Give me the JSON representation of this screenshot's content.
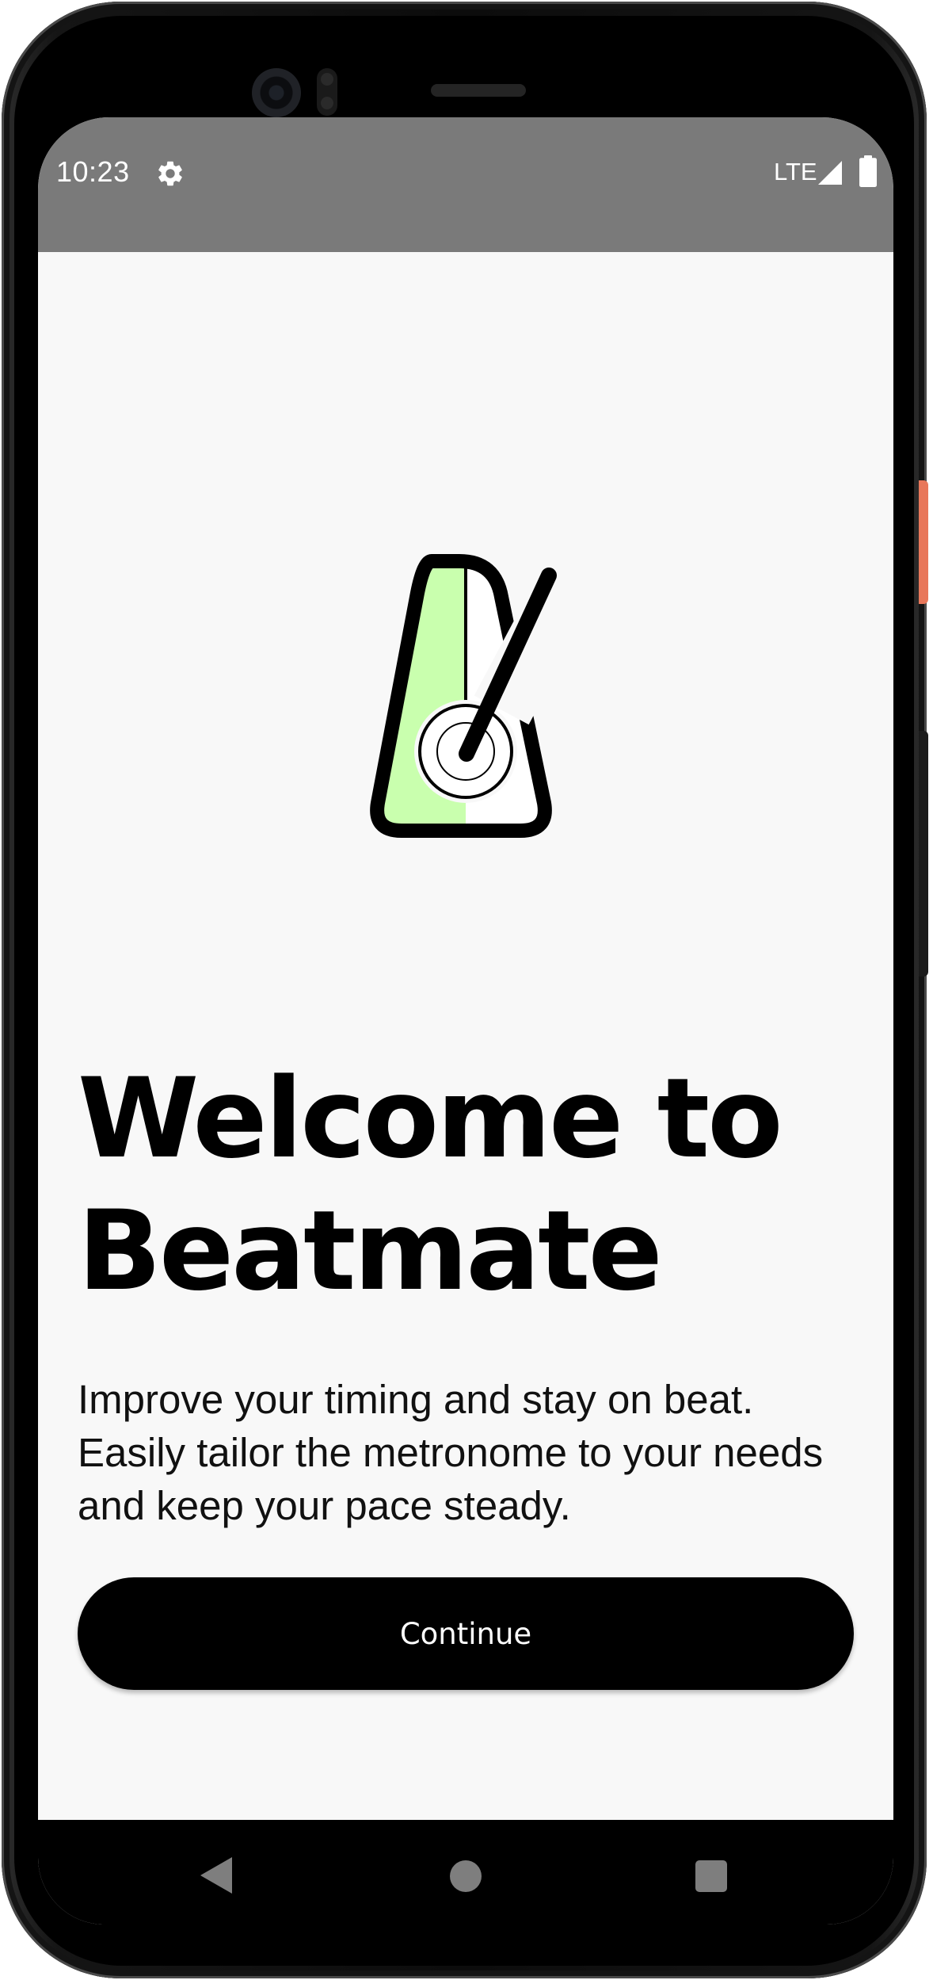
{
  "status_bar": {
    "time": "10:23",
    "network": "LTE",
    "icons": [
      "gear-icon",
      "signal-icon",
      "battery-icon"
    ]
  },
  "onboarding": {
    "logo_icon": "metronome-icon",
    "title": "Welcome to Beatmate",
    "subtitle": "Improve your timing and stay on beat. Easily tailor the metronome to your needs and keep your pace steady.",
    "continue_label": "Continue"
  },
  "nav_bar": {
    "icons": [
      "back-icon",
      "home-icon",
      "recents-icon"
    ]
  },
  "colors": {
    "status_bar": "#7a7a7a",
    "background": "#f8f8f8",
    "logo_accent": "#c9ffae",
    "button": "#000000",
    "button_text": "#ffffff"
  }
}
